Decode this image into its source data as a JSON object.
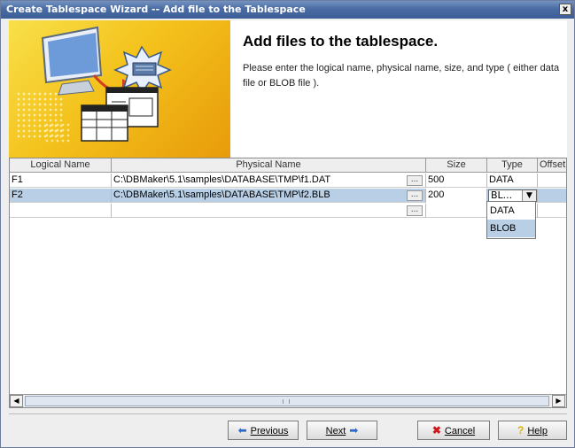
{
  "window": {
    "title": "Create Tablespace Wizard -- Add file to the Tablespace",
    "close_label": "x"
  },
  "header": {
    "heading": "Add files to the tablespace.",
    "description": "Please enter the logical name, physical name, size, and type ( either data file or BLOB file )."
  },
  "table": {
    "columns": [
      "Logical Name",
      "Physical Name",
      "Size",
      "Type",
      "Offset"
    ],
    "rows": [
      {
        "logical": "F1",
        "physical": "C:\\DBMaker\\5.1\\samples\\DATABASE\\TMP\\f1.DAT",
        "browse": "...",
        "size": "500",
        "type": "DATA"
      },
      {
        "logical": "F2",
        "physical": "C:\\DBMaker\\5.1\\samples\\DATABASE\\TMP\\f2.BLB",
        "browse": "...",
        "size": "200",
        "type": "BL..."
      },
      {
        "logical": "",
        "physical": "",
        "browse": "...",
        "size": "",
        "type": ""
      }
    ],
    "type_dropdown": {
      "options": [
        "DATA",
        "BLOB"
      ],
      "selected": "BLOB"
    }
  },
  "scrollbar": {
    "left_arrow": "◀",
    "right_arrow": "▶"
  },
  "buttons": {
    "previous": "Previous",
    "next": "Next",
    "cancel": "Cancel",
    "help": "Help"
  },
  "colors": {
    "title_bar": "#4a6ca3",
    "selection": "#b8cfe5",
    "banner": "#f4c21c"
  }
}
